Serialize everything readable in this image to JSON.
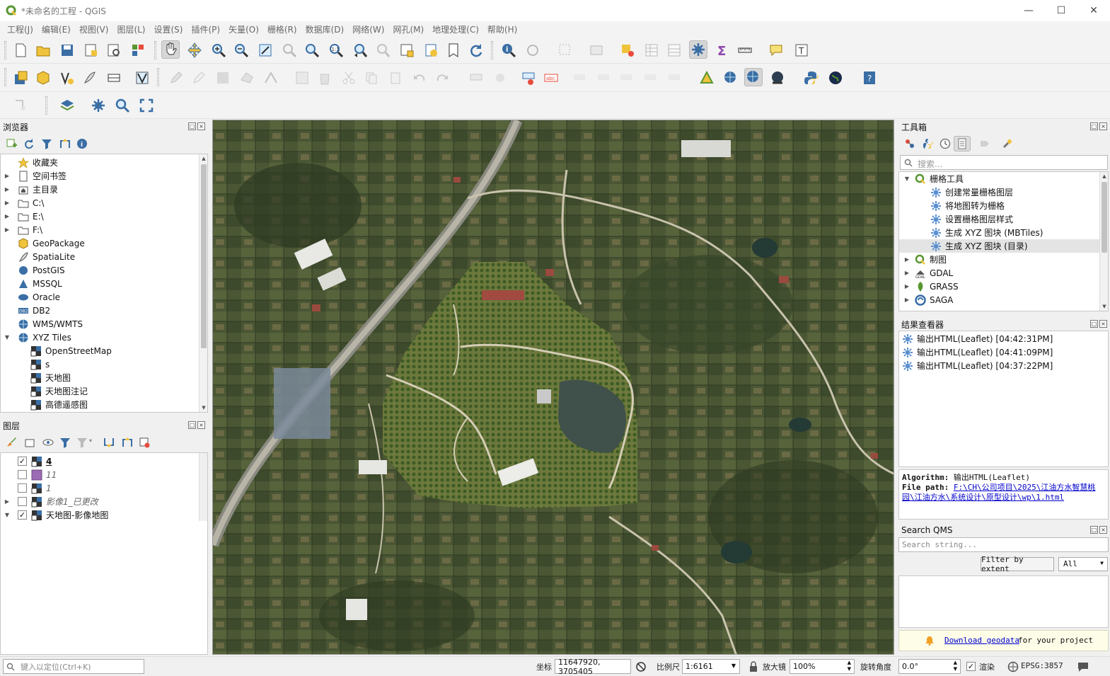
{
  "window": {
    "title": "*未命名的工程 - QGIS",
    "controls": [
      "minimize",
      "maximize",
      "close"
    ]
  },
  "menu": [
    "工程(J)",
    "编辑(E)",
    "视图(V)",
    "图层(L)",
    "设置(S)",
    "插件(P)",
    "矢量(O)",
    "栅格(R)",
    "数据库(D)",
    "网络(W)",
    "网孔(M)",
    "地理处理(C)",
    "帮助(H)"
  ],
  "browser": {
    "title": "浏览器",
    "items": [
      {
        "label": "收藏夹",
        "icon": "star-icon",
        "expander": ""
      },
      {
        "label": "空间书签",
        "icon": "bookmark-icon",
        "expander": "▶"
      },
      {
        "label": "主目录",
        "icon": "home-folder-icon",
        "expander": "▶"
      },
      {
        "label": "C:\\",
        "icon": "folder-icon",
        "expander": "▶"
      },
      {
        "label": "E:\\",
        "icon": "folder-icon",
        "expander": "▶"
      },
      {
        "label": "F:\\",
        "icon": "folder-icon",
        "expander": "▶"
      },
      {
        "label": "GeoPackage",
        "icon": "geopackage-icon",
        "expander": ""
      },
      {
        "label": "SpatiaLite",
        "icon": "spatialite-icon",
        "expander": ""
      },
      {
        "label": "PostGIS",
        "icon": "postgis-icon",
        "expander": ""
      },
      {
        "label": "MSSQL",
        "icon": "mssql-icon",
        "expander": ""
      },
      {
        "label": "Oracle",
        "icon": "oracle-icon",
        "expander": ""
      },
      {
        "label": "DB2",
        "icon": "db2-icon",
        "expander": ""
      },
      {
        "label": "WMS/WMTS",
        "icon": "wms-icon",
        "expander": ""
      },
      {
        "label": "XYZ Tiles",
        "icon": "xyz-icon",
        "expander": "▼"
      },
      {
        "label": "OpenStreetMap",
        "icon": "tile-layer-icon",
        "expander": "",
        "indent": true
      },
      {
        "label": "s",
        "icon": "tile-layer-icon",
        "expander": "",
        "indent": true
      },
      {
        "label": "天地图",
        "icon": "tile-layer-icon",
        "expander": "",
        "indent": true
      },
      {
        "label": "天地图注记",
        "icon": "tile-layer-icon",
        "expander": "",
        "indent": true
      },
      {
        "label": "高德遥感图",
        "icon": "tile-layer-icon",
        "expander": "",
        "indent": true
      }
    ]
  },
  "layers": {
    "title": "图层",
    "items": [
      {
        "label": "4",
        "checked": true,
        "icon": "raster-icon",
        "style": "bold-underline",
        "expander": ""
      },
      {
        "label": "11",
        "checked": false,
        "icon": "polygon-fill-icon",
        "style": "italic",
        "expander": ""
      },
      {
        "label": "1",
        "checked": false,
        "icon": "raster-icon",
        "style": "italic",
        "expander": ""
      },
      {
        "label": "影像1_已更改",
        "checked": false,
        "icon": "raster-icon",
        "style": "italic",
        "expander": "▶"
      },
      {
        "label": "天地图-影像地图",
        "checked": true,
        "icon": "raster-icon",
        "style": "normal",
        "expander": "▼"
      }
    ]
  },
  "toolbox": {
    "title": "工具箱",
    "search_placeholder": "搜索...",
    "groups": [
      {
        "label": "栅格工具",
        "icon": "qgis-icon",
        "expander": "▼"
      },
      {
        "label": "创建常量栅格图层",
        "icon": "gear-icon",
        "child": true
      },
      {
        "label": "将地图转为栅格",
        "icon": "gear-icon",
        "child": true
      },
      {
        "label": "设置栅格图层样式",
        "icon": "gear-icon",
        "child": true
      },
      {
        "label": "生成 XYZ 图块 (MBTiles)",
        "icon": "gear-icon",
        "child": true
      },
      {
        "label": "生成 XYZ 图块 (目录)",
        "icon": "gear-icon",
        "child": true,
        "selected": true
      },
      {
        "label": "制图",
        "icon": "qgis-icon",
        "expander": "▶"
      },
      {
        "label": "GDAL",
        "icon": "gdal-icon",
        "expander": "▶"
      },
      {
        "label": "GRASS",
        "icon": "grass-icon",
        "expander": "▶"
      },
      {
        "label": "SAGA",
        "icon": "saga-icon",
        "expander": "▶"
      }
    ]
  },
  "results": {
    "title": "结果查看器",
    "items": [
      "输出HTML(Leaflet) [04:42:31PM]",
      "输出HTML(Leaflet) [04:41:09PM]",
      "输出HTML(Leaflet) [04:37:22PM]"
    ],
    "algorithm_label": "Algorithm:",
    "algorithm_value": "输出HTML(Leaflet)",
    "filepath_label": "File path:",
    "filepath_value_1": "F:\\CH\\公司项目\\2025\\江油方水智慧桃",
    "filepath_value_2": "园\\江油方水\\系统设计\\原型设计\\wp\\1.html"
  },
  "qms": {
    "title": "Search QMS",
    "search_placeholder": "Search string...",
    "filter_button": "Filter by extent",
    "filter_select": "All",
    "footer_link": "Download geodata",
    "footer_text": "for your project"
  },
  "status": {
    "locate_placeholder": "键入以定位(Ctrl+K)",
    "coord_label": "坐标",
    "coord_value": "11647920, 3705405",
    "scale_label": "比例尺",
    "scale_value": "1:6161",
    "magnifier_label": "放大镜",
    "magnifier_value": "100%",
    "rotation_label": "旋转角度",
    "rotation_value": "0.0°",
    "render_label": "渲染",
    "render_checked": true,
    "crs": "EPSG:3857"
  },
  "colors": {
    "accent_green": "#589632",
    "qgis_yellow": "#f0c33c",
    "link": "#0000cc"
  }
}
